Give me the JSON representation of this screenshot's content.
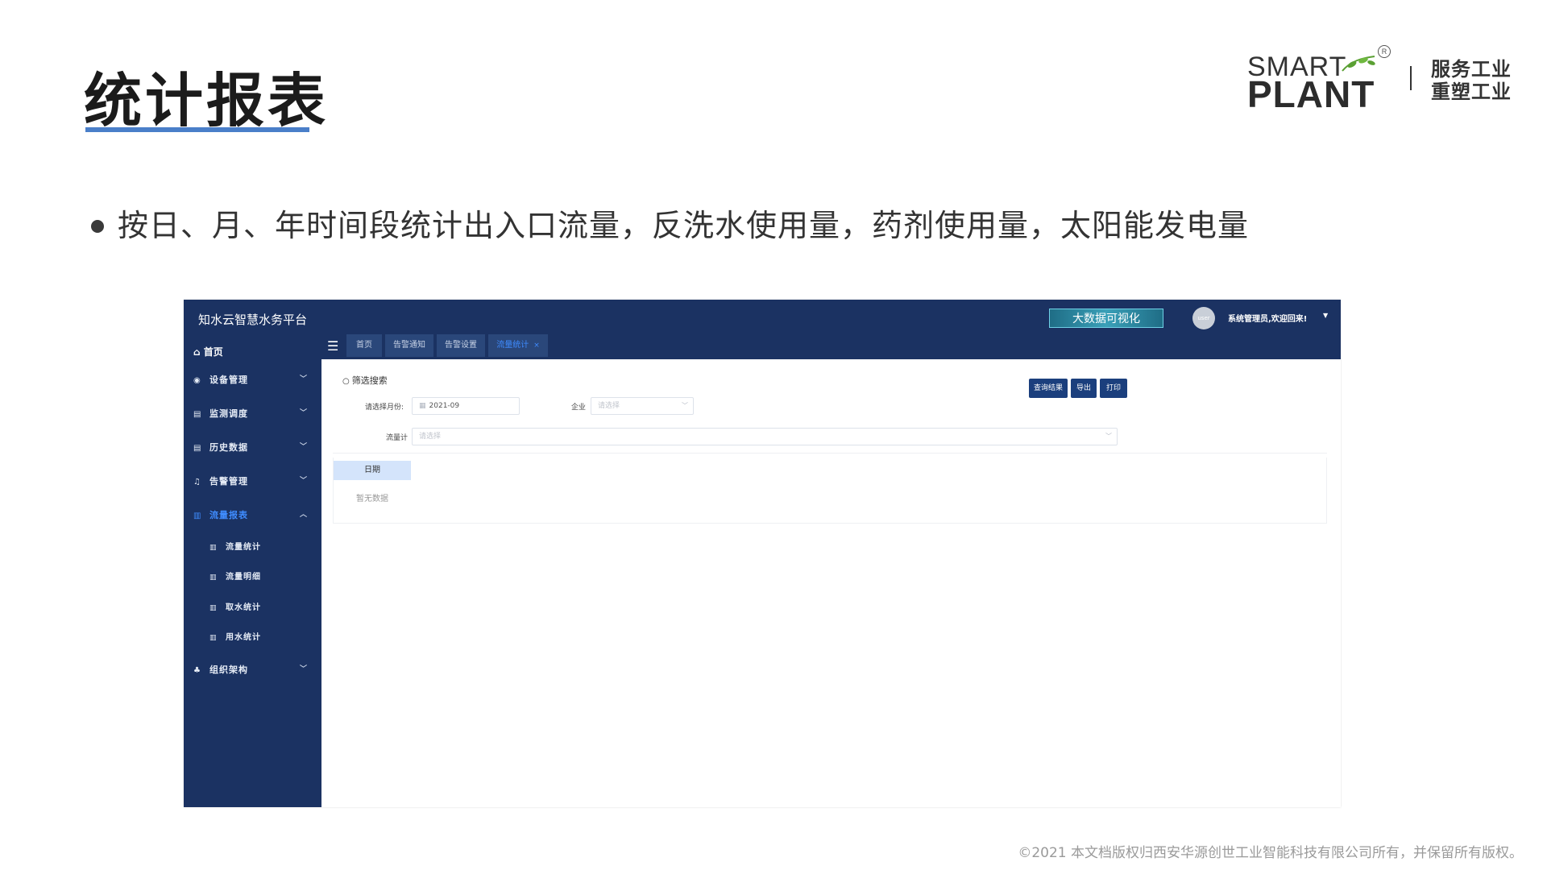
{
  "slide": {
    "title": "统计报表",
    "bullet": "按日、月、年时间段统计出入口流量，反洗水使用量，药剂使用量，太阳能发电量",
    "footer": "©2021 本文档版权归西安华源创世工业智能科技有限公司所有，并保留所有版权。"
  },
  "logo": {
    "smart": "SMART",
    "plant": "PLANT",
    "registered": "R",
    "tagline_1": "服务工业",
    "tagline_2": "重塑工业"
  },
  "app": {
    "title": "知水云智慧水务平台",
    "bigdata_button": "大数据可视化",
    "avatar_text": "user",
    "user_greeting": "系统管理员,欢迎回来!",
    "tabs": [
      {
        "label": "首页",
        "active": false
      },
      {
        "label": "告警通知",
        "active": false
      },
      {
        "label": "告警设置",
        "active": false
      },
      {
        "label": "流量统计",
        "active": true,
        "close": "×"
      }
    ],
    "sidebar": {
      "home": "首页",
      "items": [
        {
          "label": "设备管理",
          "icon": "settings-icon",
          "expanded": false
        },
        {
          "label": "监测调度",
          "icon": "monitor-icon",
          "expanded": false
        },
        {
          "label": "历史数据",
          "icon": "database-icon",
          "expanded": false
        },
        {
          "label": "告警管理",
          "icon": "bell-icon",
          "expanded": false
        },
        {
          "label": "流量报表",
          "icon": "chart-icon",
          "expanded": true,
          "active": true
        },
        {
          "label": "组织架构",
          "icon": "org-icon",
          "expanded": false
        }
      ],
      "subitems": [
        "流量统计",
        "流量明细",
        "取水统计",
        "用水统计"
      ]
    },
    "filter": {
      "title": "筛选搜索",
      "month_label": "请选择月份:",
      "month_value": "2021-09",
      "company_label": "企业",
      "company_placeholder": "请选择",
      "meter_label": "流量计",
      "meter_placeholder": "请选择"
    },
    "actions": {
      "query": "查询结果",
      "export": "导出",
      "print": "打印"
    },
    "table": {
      "column_date": "日期",
      "empty": "暂无数据"
    },
    "colors": {
      "nav_bg": "#1b3262",
      "tab_bg": "#2a477a",
      "accent": "#3f8cff",
      "button_bg": "#1b3f7d",
      "header_cell_bg": "#d4e4fb"
    }
  }
}
